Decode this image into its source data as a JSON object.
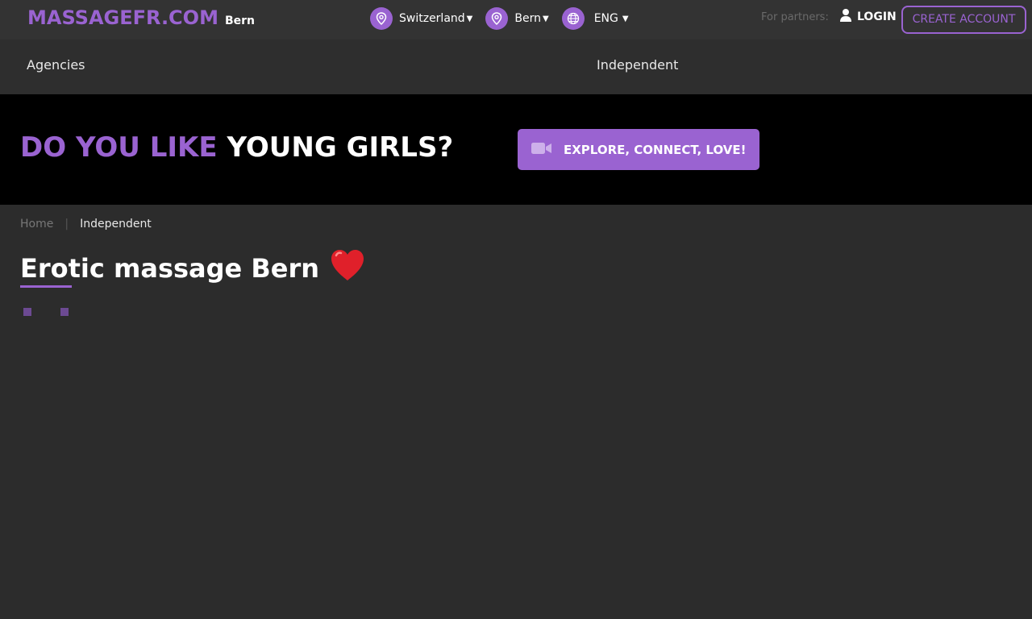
{
  "header": {
    "logo": "MASSAGEFR.COM",
    "city": "Bern",
    "country_selector": "Switzerland",
    "city_selector": "Bern",
    "language_selector": "ENG",
    "partners_label": "For partners:",
    "login_label": "LOGIN",
    "create_account_label": "CREATE ACCOUNT"
  },
  "nav": {
    "items": [
      {
        "label": "Agencies"
      },
      {
        "label": "Independent"
      }
    ]
  },
  "banner": {
    "text_accent": "DO YOU LIKE",
    "text_white": "YOUNG GIRLS?",
    "button_label": "EXPLORE, CONNECT, LOVE!"
  },
  "breadcrumb": {
    "home": "Home",
    "current": "Independent"
  },
  "page": {
    "title": "Erotic massage Bern"
  },
  "colors": {
    "accent": "#9a63d1",
    "background": "#2c2c2c",
    "topbar": "#333333",
    "banner": "#000000"
  },
  "icons": {
    "location": "location-pin-icon",
    "globe": "globe-icon",
    "user": "user-icon",
    "video": "video-camera-icon",
    "heart": "heart-icon"
  }
}
